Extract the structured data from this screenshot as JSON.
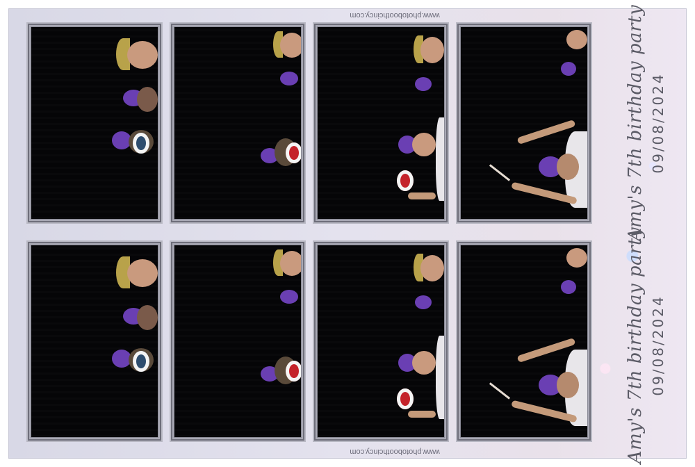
{
  "strips": [
    {
      "watermark": "www.photoboothcincy.com",
      "caption_title": "Amy's 7th birthday party",
      "caption_date": "09/08/2024"
    },
    {
      "watermark": "www.photoboothcincy.com",
      "caption_title": "Amy's 7th birthday party",
      "caption_date": "09/08/2024"
    }
  ]
}
